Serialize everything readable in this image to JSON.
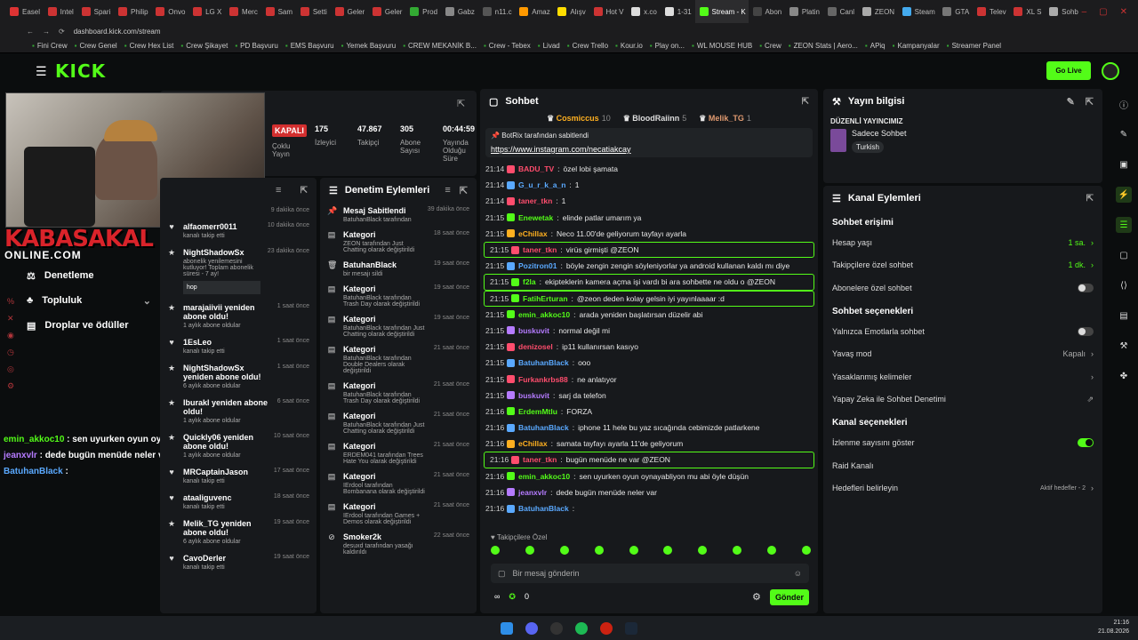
{
  "tabs": [
    "Easel",
    "Intel",
    "Spari",
    "Philip",
    "Onvo",
    "LG X",
    "Merc",
    "Sam",
    "Setti",
    "Geler",
    "Geler",
    "Prod",
    "Gabz",
    "n11.c",
    "Amaz",
    "Alışv",
    "Hot V",
    "x.co",
    "1-31",
    "Stream - K",
    "Abon",
    "Platin",
    "Canl",
    "ZEON",
    "Steam",
    "GTA",
    "Telev",
    "XL S",
    "Sohb"
  ],
  "active_tab": "Stream - K",
  "url": "dashboard.kick.com/stream",
  "bookmarks": [
    "Fini Crew",
    "Crew Genel",
    "Crew Hex List",
    "Crew Şikayet",
    "PD Başvuru",
    "EMS Başvuru",
    "Yemek Başvuru",
    "CREW MEKANİK B...",
    "Crew - Tebex",
    "Livad",
    "Crew Trello",
    "Kour.io",
    "Play on...",
    "WL MOUSE HUB",
    "Crew",
    "ZEON Stats | Aero...",
    "APiq",
    "Kampanyalar",
    "Streamer Panel"
  ],
  "logo": "KICK",
  "golive": "Go Live",
  "overlay": {
    "logo": "KABASAKAL",
    "sub": "ONLINE.COM"
  },
  "stats": [
    {
      "v": "KAPALI",
      "l": "Çoklu Yayın"
    },
    {
      "v": "175",
      "l": "İzleyici"
    },
    {
      "v": "47.867",
      "l": "Takipçi"
    },
    {
      "v": "305",
      "l": "Abone Sayısı"
    },
    {
      "v": "00:44:59",
      "l": "Yayında Olduğu Süre"
    }
  ],
  "leftnav": [
    {
      "label": "Denetleme",
      "icon": "gavel-icon"
    },
    {
      "label": "Topluluk",
      "icon": "users-icon"
    },
    {
      "label": "Droplar ve ödüller",
      "icon": "gift-icon"
    }
  ],
  "overlay_chat": [
    {
      "u": "emin_akkoc10",
      "m": "sen uyurken oyun oynayabliyon mu abi öyle düşün",
      "c": "#53fc18"
    },
    {
      "u": "jeanxvlr",
      "m": "dede bugün menüde neler var",
      "c": "#b57bff"
    },
    {
      "u": "BatuhanBlack",
      "m": "",
      "c": "#5aa9ff"
    }
  ],
  "activity_first": "9 dakika önce",
  "activity": [
    {
      "t": "alfaomerr0011",
      "s": "kanalı takip etti",
      "tm": "10 dakika önce",
      "ic": "heart-icon"
    },
    {
      "t": "NightShadowSx",
      "s": "abonelik yenilemesini kutluyor! Toplam abonelik süresi - 7 ay!",
      "tm": "23 dakika önce",
      "ic": "star-icon",
      "note": "hop"
    },
    {
      "t": "marajaiivii yeniden abone oldu!",
      "s": "1 aylık abone oldular",
      "tm": "1 saat önce",
      "ic": "star-icon"
    },
    {
      "t": "1EsLeo",
      "s": "kanalı takip etti",
      "tm": "1 saat önce",
      "ic": "heart-icon"
    },
    {
      "t": "NightShadowSx yeniden abone oldu!",
      "s": "6 aylık abone oldular",
      "tm": "1 saat önce",
      "ic": "star-icon"
    },
    {
      "t": "Iburakl yeniden abone oldu!",
      "s": "1 aylık abone oldular",
      "tm": "6 saat önce",
      "ic": "star-icon"
    },
    {
      "t": "Quickly06 yeniden abone oldu!",
      "s": "1 aylık abone oldular",
      "tm": "10 saat önce",
      "ic": "star-icon"
    },
    {
      "t": "MRCaptainJason",
      "s": "kanalı takip etti",
      "tm": "17 saat önce",
      "ic": "heart-icon"
    },
    {
      "t": "ataaliguvenc",
      "s": "kanalı takip etti",
      "tm": "18 saat önce",
      "ic": "heart-icon"
    },
    {
      "t": "Melik_TG yeniden abone oldu!",
      "s": "6 aylık abone oldular",
      "tm": "19 saat önce",
      "ic": "star-icon"
    },
    {
      "t": "CavoDerler",
      "s": "kanalı takip etti",
      "tm": "19 saat önce",
      "ic": "heart-icon"
    }
  ],
  "mod": {
    "title": "Denetim Eylemleri",
    "items": [
      {
        "t": "Mesaj Sabitlendi",
        "s": "BatuhanBlack tarafından",
        "tm": "39 dakika önce",
        "ic": "pin-icon"
      },
      {
        "t": "Kategori",
        "s": "ZEON tarafından Just Chatting olarak değiştirildi",
        "tm": "18 saat önce",
        "ic": "receipt-icon"
      },
      {
        "t": "BatuhanBlack",
        "s": "bir mesajı sildi",
        "tm": "19 saat önce",
        "ic": "trash-icon"
      },
      {
        "t": "Kategori",
        "s": "BatuhanBlack tarafından Trash Day olarak değiştirildi",
        "tm": "19 saat önce",
        "ic": "receipt-icon"
      },
      {
        "t": "Kategori",
        "s": "BatuhanBlack tarafından Just Chatting olarak değiştirildi",
        "tm": "19 saat önce",
        "ic": "receipt-icon"
      },
      {
        "t": "Kategori",
        "s": "BatuhanBlack tarafından Double Dealers olarak değiştirildi",
        "tm": "21 saat önce",
        "ic": "receipt-icon"
      },
      {
        "t": "Kategori",
        "s": "BatuhanBlack tarafından Trash Day olarak değiştirildi",
        "tm": "21 saat önce",
        "ic": "receipt-icon"
      },
      {
        "t": "Kategori",
        "s": "BatuhanBlack tarafından Just Chatting olarak değiştirildi",
        "tm": "21 saat önce",
        "ic": "receipt-icon"
      },
      {
        "t": "Kategori",
        "s": "ERDEM041 tarafından Trees Hate You olarak değiştirildi",
        "tm": "21 saat önce",
        "ic": "receipt-icon"
      },
      {
        "t": "Kategori",
        "s": "IErdool tarafından Bombanana olarak değiştirildi",
        "tm": "21 saat önce",
        "ic": "receipt-icon"
      },
      {
        "t": "Kategori",
        "s": "IErdool tarafından Games + Demos olarak değiştirildi",
        "tm": "21 saat önce",
        "ic": "receipt-icon"
      },
      {
        "t": "Smoker2k",
        "s": "desuxd tarafından yasağı kaldırıldı",
        "tm": "22 saat önce",
        "ic": "ban-icon"
      }
    ]
  },
  "chat": {
    "title": "Sohbet",
    "top": [
      {
        "u": "Cosmiccus",
        "n": "10"
      },
      {
        "u": "BloodRaiinn",
        "n": "5"
      },
      {
        "u": "Melik_TG",
        "n": "1"
      }
    ],
    "pinned_by": "BotRix tarafından sabitlendi",
    "pinned_link": "https://www.instagram.com/necatiakcay",
    "messages": [
      {
        "t": "21:14",
        "u": "BADU_TV",
        "m": "özel lobi şamata",
        "c": "#ff4d6d"
      },
      {
        "t": "21:14",
        "u": "G_u_r_k_a_n",
        "m": "1",
        "c": "#5aa9ff"
      },
      {
        "t": "21:14",
        "u": "taner_tkn",
        "m": "1",
        "c": "#ff4d6d"
      },
      {
        "t": "21:15",
        "u": "Enewetak",
        "m": "elinde patlar umarım ya",
        "c": "#53fc18"
      },
      {
        "t": "21:15",
        "u": "eChillax",
        "m": "Neco 11.00'de geliyorum tayfayı ayarla",
        "c": "#ffb020"
      },
      {
        "t": "21:15",
        "u": "taner_tkn",
        "m": "virüs girmişti @ZEON",
        "c": "#ff4d6d",
        "hl": true
      },
      {
        "t": "21:15",
        "u": "Pozitron01",
        "m": "böyle zengin zengin söyleniyorlar ya android kullanan kaldı mı diye",
        "c": "#5aa9ff"
      },
      {
        "t": "21:15",
        "u": "f2la",
        "m": "ekipteklerin kamera açma işi vardı bi ara sohbette ne oldu o @ZEON",
        "c": "#53fc18",
        "hl": true
      },
      {
        "t": "21:15",
        "u": "FatihErturan",
        "m": "@zeon deden kolay gelsin iyi yayınlaaaar :d",
        "c": "#53fc18",
        "hl": true
      },
      {
        "t": "21:15",
        "u": "emin_akkoc10",
        "m": "arada yeniden başlatırsan düzelir abi",
        "c": "#53fc18"
      },
      {
        "t": "21:15",
        "u": "buskuvit",
        "m": "normal değil mi",
        "c": "#b57bff"
      },
      {
        "t": "21:15",
        "u": "denizosel",
        "m": "ip11 kullanırsan kasıyo",
        "c": "#ff4d6d"
      },
      {
        "t": "21:15",
        "u": "BatuhanBlack",
        "m": "ooo",
        "c": "#5aa9ff"
      },
      {
        "t": "21:15",
        "u": "Furkankrbs88",
        "m": "ne anlatıyor",
        "c": "#ff4d6d"
      },
      {
        "t": "21:15",
        "u": "buskuvit",
        "m": "sarj da telefon",
        "c": "#b57bff"
      },
      {
        "t": "21:16",
        "u": "ErdemMtlu",
        "m": "FORZA",
        "c": "#53fc18"
      },
      {
        "t": "21:16",
        "u": "BatuhanBlack",
        "m": "iphone 11 hele bu yaz sıcağında cebimizde patlarkene",
        "c": "#5aa9ff"
      },
      {
        "t": "21:16",
        "u": "eChillax",
        "m": "samata tayfayı ayarla 11'de geliyorum",
        "c": "#ffb020"
      },
      {
        "t": "21:16",
        "u": "taner_tkn",
        "m": "bugün menüde ne var @ZEON",
        "c": "#ff4d6d",
        "hl": true
      },
      {
        "t": "21:16",
        "u": "emin_akkoc10",
        "m": "sen uyurken oyun oynayabliyon mu abi öyle düşün",
        "c": "#53fc18"
      },
      {
        "t": "21:16",
        "u": "jeanxvlr",
        "m": "dede bugün menüde neler var",
        "c": "#b57bff"
      },
      {
        "t": "21:16",
        "u": "BatuhanBlack",
        "m": "",
        "c": "#5aa9ff"
      }
    ],
    "followers_only": "Takipçilere Özel",
    "placeholder": "Bir mesaj gönderin",
    "points": "0",
    "send": "Gönder"
  },
  "info": {
    "title": "Yayın bilgisi",
    "label": "DÜZENLİ YAYINCIMIZ",
    "category": "Sadece Sohbet",
    "tag": "Turkish"
  },
  "channel": {
    "title": "Kanal Eylemleri",
    "sections": [
      {
        "h": "Sohbet erişimi",
        "rows": [
          {
            "l": "Hesap yaşı",
            "v": "1 sa.",
            "kind": "chev",
            "green": true
          },
          {
            "l": "Takipçilere özel sohbet",
            "v": "1 dk.",
            "kind": "chev",
            "green": true
          },
          {
            "l": "Abonelere özel sohbet",
            "v": "",
            "kind": "toggle"
          }
        ]
      },
      {
        "h": "Sohbet seçenekleri",
        "rows": [
          {
            "l": "Yalnızca Emotlarla sohbet",
            "v": "",
            "kind": "toggle"
          },
          {
            "l": "Yavaş mod",
            "v": "Kapalı",
            "kind": "chev"
          },
          {
            "l": "Yasaklanmış kelimeler",
            "v": "",
            "kind": "chev"
          },
          {
            "l": "Yapay Zeka ile Sohbet Denetimi",
            "v": "",
            "kind": "ext"
          }
        ]
      },
      {
        "h": "Kanal seçenekleri",
        "rows": [
          {
            "l": "İzlenme sayısını göster",
            "v": "",
            "kind": "toggleon"
          },
          {
            "l": "Raid Kanalı",
            "v": "",
            "kind": "none"
          },
          {
            "l": "Hedefleri belirleyin",
            "v": "Aktif hedefler - 2",
            "kind": "chev"
          }
        ]
      }
    ]
  },
  "clock": {
    "time": "21:16",
    "date": "21.08.2026"
  }
}
